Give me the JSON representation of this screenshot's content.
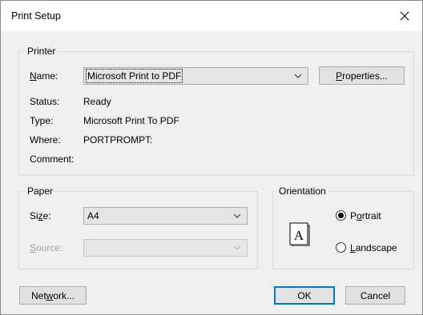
{
  "window": {
    "title": "Print Setup",
    "close_glyph": "✕"
  },
  "printer": {
    "group_label": "Printer",
    "name_label_mnemonic": "N",
    "name_label_rest": "ame:",
    "selected_printer": "Microsoft Print to PDF",
    "properties_mnemonic": "P",
    "properties_rest": "roperties...",
    "status_label": "Status:",
    "status_value": "Ready",
    "type_label": "Type:",
    "type_value": "Microsoft Print To PDF",
    "where_label": "Where:",
    "where_value": "PORTPROMPT:",
    "comment_label": "Comment:",
    "comment_value": ""
  },
  "paper": {
    "group_label": "Paper",
    "size_label_pre": "Si",
    "size_label_mnemonic": "z",
    "size_label_post": "e:",
    "size_value": "A4",
    "source_label_mnemonic": "S",
    "source_label_rest": "ource:",
    "source_value": ""
  },
  "orientation": {
    "group_label": "Orientation",
    "icon_letter": "A",
    "portrait_pre": "P",
    "portrait_mnemonic": "o",
    "portrait_post": "rtrait",
    "portrait_selected": true,
    "landscape_mnemonic": "L",
    "landscape_rest": "andscape",
    "landscape_selected": false
  },
  "buttons": {
    "network_pre": "Net",
    "network_mnemonic": "w",
    "network_post": "ork...",
    "ok": "OK",
    "cancel": "Cancel"
  },
  "icons": {
    "close": "close-icon",
    "dropdown": "chevron-down-icon",
    "orientation": "portrait-page-icon"
  },
  "colors": {
    "dialog_bg": "#f0f0f0",
    "titlebar_bg": "#ffffff",
    "default_button_border": "#0078d7",
    "button_bg": "#e1e1e1",
    "disabled_text": "#a0a0a0"
  }
}
